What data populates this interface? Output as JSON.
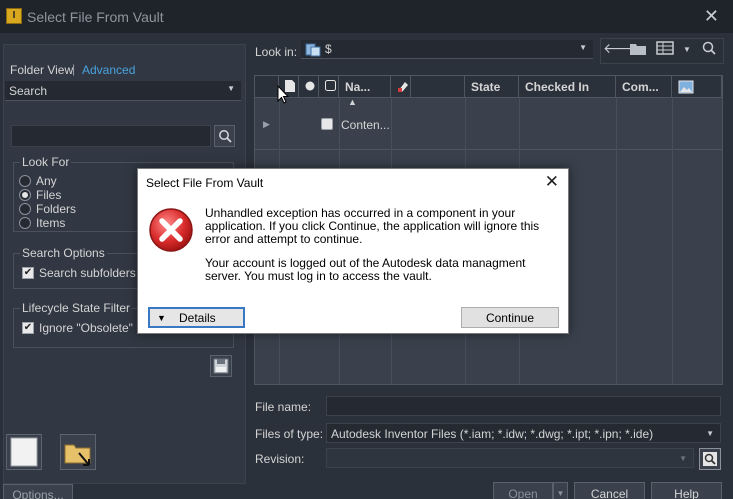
{
  "window": {
    "title": "Select File From Vault",
    "app_icon_text": "I"
  },
  "left": {
    "tabs": {
      "folder_view": "Folder View",
      "separator": "|",
      "advanced": "Advanced"
    },
    "search_combo": "Search",
    "search_input": "",
    "look_for": {
      "title": "Look For",
      "options": [
        "Any",
        "Files",
        "Folders",
        "Items"
      ],
      "selected": "Files"
    },
    "search_options": {
      "title": "Search Options",
      "subfolders_label": "Search subfolders",
      "subfolders_checked": true
    },
    "lifecycle": {
      "title": "Lifecycle State Filter",
      "ignore_label": "Ignore \"Obsolete\" St",
      "ignore_checked": true
    },
    "options_button": "Options..."
  },
  "right": {
    "look_in_label": "Look in:",
    "look_in_value": "$",
    "grid": {
      "columns": [
        "Na...",
        "State",
        "Checked In",
        "Com..."
      ],
      "sort_indicator": "▲",
      "rows": [
        {
          "name": "Conten..."
        }
      ]
    },
    "file_name_label": "File name:",
    "file_name_value": "",
    "files_of_type_label": "Files of type:",
    "files_of_type_value": "Autodesk Inventor Files (*.iam; *.idw; *.dwg; *.ipt; *.ipn; *.ide)",
    "revision_label": "Revision:",
    "revision_value": "",
    "buttons": {
      "open": "Open",
      "cancel": "Cancel",
      "help": "Help"
    }
  },
  "modal": {
    "title": "Select File From Vault",
    "message1": "Unhandled exception has occurred in a component in your application. If you click Continue, the application will ignore this error and attempt to continue.",
    "message2": "Your account is logged out of the Autodesk data managment server. You must log in to access the vault.",
    "details_label": "Details",
    "continue_label": "Continue"
  },
  "colors": {
    "accent_link": "#4aa3df",
    "error_red": "#d92b2b",
    "focus_blue": "#3b78c4"
  }
}
